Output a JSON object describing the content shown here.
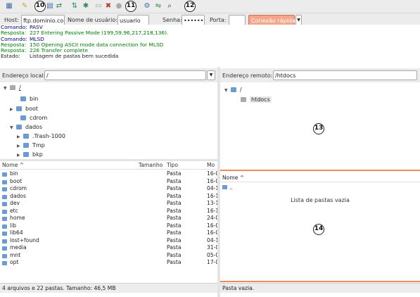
{
  "toolbar": {
    "icons": [
      "site-manager-icon",
      "message-log-icon",
      "local-tree-icon",
      "remote-tree-icon",
      "transfer-queue-icon",
      "refresh-icon",
      "process-queue-icon",
      "cancel-icon",
      "disconnect-icon",
      "reconnect-icon",
      "directory-listing-filters-icon",
      "sync-browsing-icon",
      "dir-comparison-icon",
      "search-remote-icon"
    ],
    "callouts": [
      "10",
      "11",
      "12"
    ]
  },
  "quickconnect": {
    "host_label": "Host:",
    "host_value": "ftp.dominio.co",
    "user_label": "Nome de usuário:",
    "user_value": "usuario",
    "pass_label": "Senha:",
    "pass_value": "••••••••",
    "port_label": "Porta:",
    "port_value": "",
    "connect_label": "Conexão rápida"
  },
  "log": [
    {
      "label": "Comando:",
      "text": "PASV",
      "color": "#00008b"
    },
    {
      "label": "Resposta:",
      "text": "227 Entering Passive Mode (199,59,96,217,218,136).",
      "color": "#008000"
    },
    {
      "label": "Comando:",
      "text": "MLSD",
      "color": "#00008b"
    },
    {
      "label": "Resposta:",
      "text": "150 Opening ASCII mode data connection for MLSD",
      "color": "#008000"
    },
    {
      "label": "Resposta:",
      "text": "226 Transfer complete",
      "color": "#008000"
    },
    {
      "label": "Estado:",
      "text": "Listagem de pastas bem sucedida",
      "color": "#222222"
    }
  ],
  "local": {
    "path_label": "Endereço local:",
    "path_value": "/",
    "tree": [
      {
        "name": "/",
        "twisty": "▼",
        "level": 0
      },
      {
        "name": "bin",
        "twisty": "",
        "level": 1
      },
      {
        "name": "boot",
        "twisty": "▶",
        "level": 1
      },
      {
        "name": "cdrom",
        "twisty": "",
        "level": 1
      },
      {
        "name": "dados",
        "twisty": "▼",
        "level": 1
      },
      {
        "name": ".Trash-1000",
        "twisty": "▶",
        "level": 2
      },
      {
        "name": "Tmp",
        "twisty": "▶",
        "level": 2
      },
      {
        "name": "bkp",
        "twisty": "▶",
        "level": 2
      }
    ],
    "columns": {
      "name": "Nome ^",
      "size": "Tamanho",
      "type": "Tipo",
      "modified": "Mo"
    },
    "files": [
      {
        "name": "bin",
        "type": "Pasta",
        "mod": "16-0"
      },
      {
        "name": "boot",
        "type": "Pasta",
        "mod": "16-0"
      },
      {
        "name": "cdrom",
        "type": "Pasta",
        "mod": "04-1"
      },
      {
        "name": "dados",
        "type": "Pasta",
        "mod": "16-1"
      },
      {
        "name": "dev",
        "type": "Pasta",
        "mod": "13-1"
      },
      {
        "name": "etc",
        "type": "Pasta",
        "mod": "16-1"
      },
      {
        "name": "home",
        "type": "Pasta",
        "mod": "24-0"
      },
      {
        "name": "lib",
        "type": "Pasta",
        "mod": "16-0"
      },
      {
        "name": "lib64",
        "type": "Pasta",
        "mod": "16-0"
      },
      {
        "name": "lost+found",
        "type": "Pasta",
        "mod": "04-1"
      },
      {
        "name": "media",
        "type": "Pasta",
        "mod": "31-0"
      },
      {
        "name": "mnt",
        "type": "Pasta",
        "mod": "05-0"
      },
      {
        "name": "opt",
        "type": "Pasta",
        "mod": "17-0"
      }
    ],
    "status": "4 arquivos e 22 pastas. Tamanho: 46,5 MB"
  },
  "remote": {
    "path_label": "Endereço remoto:",
    "path_value": "/htdocs",
    "tree": [
      {
        "name": "/",
        "twisty": "▼",
        "level": 0
      },
      {
        "name": "htdocs",
        "twisty": "",
        "level": 1
      }
    ],
    "callout_tree": "13",
    "columns": {
      "name": "Nome ^"
    },
    "parent_entry": "..",
    "empty_message": "Lista de pastas vazia",
    "callout_list": "14",
    "status": "Pasta vazia."
  }
}
